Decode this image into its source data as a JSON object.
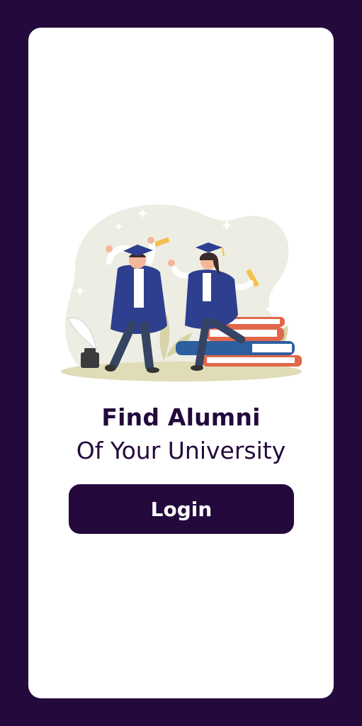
{
  "screen": {
    "heading_bold": "Find Alumni",
    "heading_light": "Of Your University",
    "login_label": "Login"
  },
  "colors": {
    "background": "#24093c",
    "card": "#ffffff",
    "button": "#24093c",
    "button_text": "#ffffff",
    "blob": "#eeede3",
    "gown": "#2d3f8e",
    "book_red": "#e2674a"
  },
  "icons": {
    "illustration": "graduates-celebrating-illustration"
  }
}
